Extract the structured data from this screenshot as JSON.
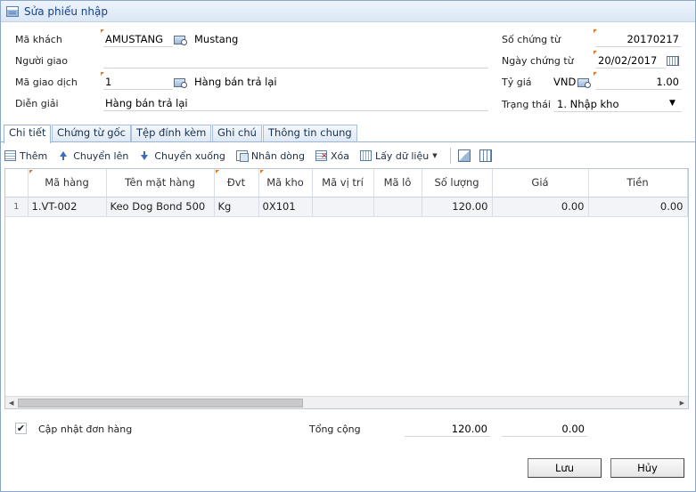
{
  "window": {
    "title": "Sửa phiếu nhập"
  },
  "form": {
    "ma_khach_label": "Mã khách",
    "ma_khach_value": "AMUSTANG",
    "ma_khach_name": "Mustang",
    "nguoi_giao_label": "Người giao",
    "nguoi_giao_value": "",
    "ma_giao_dich_label": "Mã giao dịch",
    "ma_giao_dich_value": "1",
    "ma_giao_dich_name": "Hàng bán trả lại",
    "dien_giai_label": "Diễn giải",
    "dien_giai_value": "Hàng bán trả lại",
    "so_chung_tu_label": "Số chứng từ",
    "so_chung_tu_value": "20170217",
    "ngay_chung_tu_label": "Ngày chứng từ",
    "ngay_chung_tu_value": "20/02/2017",
    "ty_gia_label": "Tỷ giá",
    "ty_gia_currency": "VND",
    "ty_gia_value": "1.00",
    "trang_thai_label": "Trạng thái",
    "trang_thai_value": "1. Nhập kho"
  },
  "tabs": [
    "Chi tiết",
    "Chứng từ gốc",
    "Tệp đính kèm",
    "Ghi chú",
    "Thông tin chung"
  ],
  "toolbar": {
    "add": "Thêm",
    "move_up": "Chuyển lên",
    "move_down": "Chuyển xuống",
    "duplicate": "Nhân dòng",
    "delete": "Xóa",
    "get_data": "Lấy dữ liệu"
  },
  "grid": {
    "columns": [
      "Mã hàng",
      "Tên mặt hàng",
      "Đvt",
      "Mã kho",
      "Mã vị trí",
      "Mã lô",
      "Số lượng",
      "Giá",
      "Tiền"
    ],
    "rows": [
      {
        "idx": "1",
        "ma_hang": "1.VT-002",
        "ten_mat_hang": "Keo Dog Bond 500",
        "dvt": "Kg",
        "ma_kho": "0X101",
        "ma_vi_tri": "",
        "ma_lo": "",
        "so_luong": "120.00",
        "gia": "0.00",
        "tien": "0.00"
      }
    ]
  },
  "footer": {
    "update_order_label": "Cập nhật đơn hàng",
    "update_order_checked": true,
    "total_label": "Tổng cộng",
    "total_qty": "120.00",
    "total_amount": "0.00"
  },
  "buttons": {
    "save": "Lưu",
    "cancel": "Hủy"
  }
}
